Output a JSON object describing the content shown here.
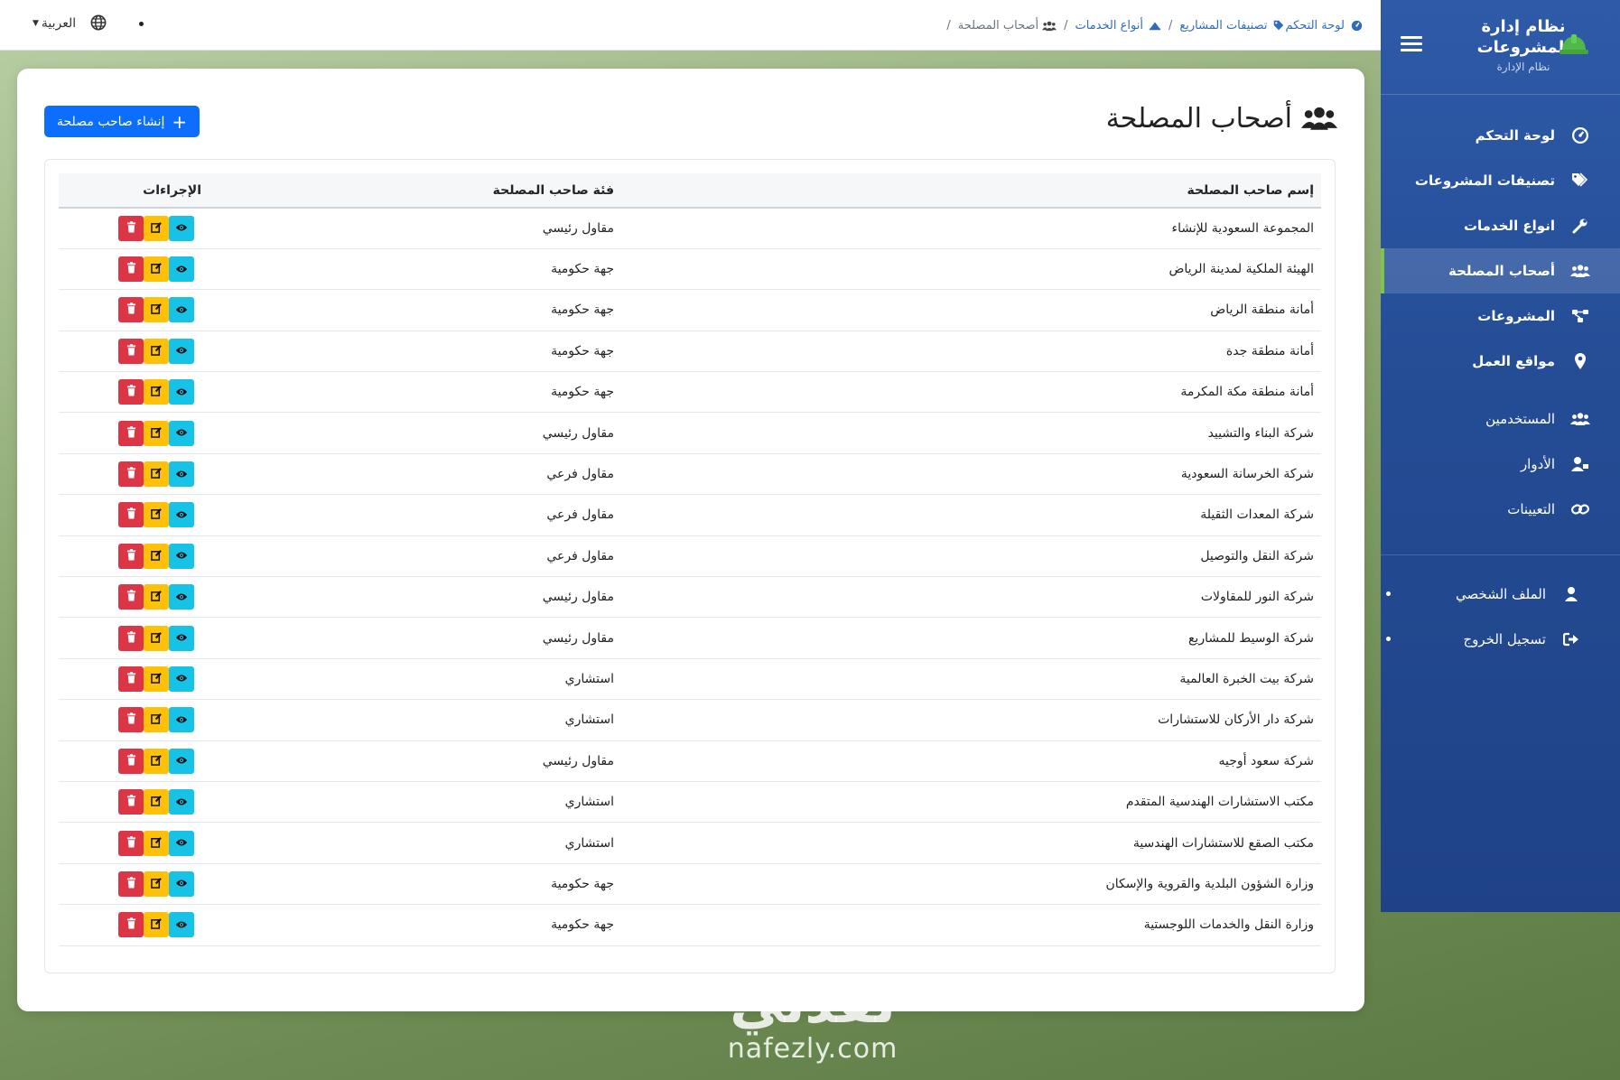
{
  "brand": {
    "title": "نظام إدارة المشروعات",
    "subtitle": "نظام الإدارة",
    "colors": {
      "sidebar": "#244c94",
      "primary": "#0d6efd",
      "view": "#16c3e6",
      "edit": "#ffc107",
      "delete": "#dc3545"
    }
  },
  "sidebar": {
    "items": [
      {
        "label": "لوحة التحكم",
        "icon": "dashboard-icon"
      },
      {
        "label": "تصنيفات المشروعات",
        "icon": "tags-icon"
      },
      {
        "label": "انواع الخدمات",
        "icon": "wrench-icon"
      },
      {
        "label": "أصحاب المصلحة",
        "icon": "users-icon"
      },
      {
        "label": "المشروعات",
        "icon": "project-diagram-icon"
      },
      {
        "label": "مواقع العمل",
        "icon": "map-marker-icon"
      },
      {
        "label": "المستخدمين",
        "icon": "users-icon"
      },
      {
        "label": "الأدوار",
        "icon": "user-tag-icon"
      },
      {
        "label": "التعيينات",
        "icon": "link-icon"
      }
    ],
    "user_items": [
      {
        "label": "الملف الشخصي",
        "icon": "user-icon"
      },
      {
        "label": "تسجيل الخروج",
        "icon": "sign-out-icon"
      }
    ]
  },
  "breadcrumb": [
    {
      "label": "لوحة التحكم"
    },
    {
      "label": "تصنيفات المشاريع"
    },
    {
      "label": "أنواع الخدمات"
    },
    {
      "label": "أصحاب المصلحة"
    }
  ],
  "topbar": {
    "language": "العربية"
  },
  "page": {
    "title": "أصحاب المصلحة",
    "create_button": "إنشاء صاحب مصلحة"
  },
  "table": {
    "headers": {
      "name": "إسم صاحب المصلحة",
      "category": "فئة صاحب المصلحة",
      "actions": "الإجراءات"
    },
    "rows": [
      {
        "name": "المجموعة السعودية للإنشاء",
        "category": "مقاول رئيسي"
      },
      {
        "name": "الهيئة الملكية لمدينة الرياض",
        "category": "جهة حكومية"
      },
      {
        "name": "أمانة منطقة الرياض",
        "category": "جهة حكومية"
      },
      {
        "name": "أمانة منطقة جدة",
        "category": "جهة حكومية"
      },
      {
        "name": "أمانة منطقة مكة المكرمة",
        "category": "جهة حكومية"
      },
      {
        "name": "شركة البناء والتشييد",
        "category": "مقاول رئيسي"
      },
      {
        "name": "شركة الخرسانة السعودية",
        "category": "مقاول فرعي"
      },
      {
        "name": "شركة المعدات الثقيلة",
        "category": "مقاول فرعي"
      },
      {
        "name": "شركة النقل والتوصيل",
        "category": "مقاول فرعي"
      },
      {
        "name": "شركة النور للمقاولات",
        "category": "مقاول رئيسي"
      },
      {
        "name": "شركة الوسيط للمشاريع",
        "category": "مقاول رئيسي"
      },
      {
        "name": "شركة بيت الخبرة العالمية",
        "category": "استشاري"
      },
      {
        "name": "شركة دار الأركان للاستشارات",
        "category": "استشاري"
      },
      {
        "name": "شركة سعود أوجيه",
        "category": "مقاول رئيسي"
      },
      {
        "name": "مكتب الاستشارات الهندسية المتقدم",
        "category": "استشاري"
      },
      {
        "name": "مكتب الصقع للاستشارات الهندسية",
        "category": "استشاري"
      },
      {
        "name": "وزارة الشؤون البلدية والقروية والإسكان",
        "category": "جهة حكومية"
      },
      {
        "name": "وزارة النقل والخدمات اللوجستية",
        "category": "جهة حكومية"
      }
    ]
  },
  "watermark": {
    "arabic": "نفذلي",
    "latin": "nafezly.com"
  }
}
